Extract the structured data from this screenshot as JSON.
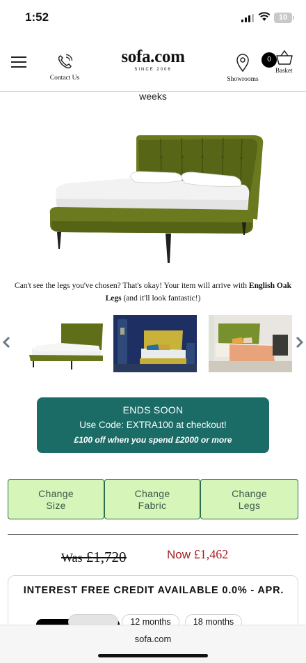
{
  "status_bar": {
    "time": "1:52",
    "battery": "10"
  },
  "header": {
    "menu_icon": "hamburger-menu-icon",
    "contact_label": "Contact Us",
    "logo": "sofa.com",
    "logo_since": "SINCE 2006",
    "showrooms_label": "Showrooms",
    "basket_count": "0",
    "basket_label": "Basket"
  },
  "delivery": {
    "weeks_text": "weeks"
  },
  "legs_note": {
    "text_before": "Can't see the legs you've chosen? That's okay! Your item will arrive with ",
    "bold": "English Oak Legs",
    "text_after": " (and it'll look fantastic!)"
  },
  "gallery": {
    "prev_icon": "chevron-left-icon",
    "next_icon": "chevron-right-icon",
    "thumbnail_count": 3
  },
  "promo": {
    "title": "ENDS SOON",
    "code_line": "Use Code: EXTRA100 at checkout!",
    "offer": "£100 off when you spend £2000 or more",
    "color": "#1b6b66"
  },
  "options": {
    "buttons": [
      {
        "line1": "Change",
        "line2": "Size"
      },
      {
        "line1": "Change",
        "line2": "Fabric"
      },
      {
        "line1": "Change",
        "line2": "Legs"
      }
    ],
    "button_color": "#d6f5b8"
  },
  "price": {
    "was_word": "Was",
    "was_amount": "£1,720",
    "now_word": "Now",
    "now_amount": "£1,462",
    "now_color": "#a51d22"
  },
  "credit": {
    "title": "INTEREST FREE CREDIT AVAILABLE 0.0% - APR.",
    "terms": [
      "12 months",
      "18 months"
    ]
  },
  "browser": {
    "url": "sofa.com"
  }
}
